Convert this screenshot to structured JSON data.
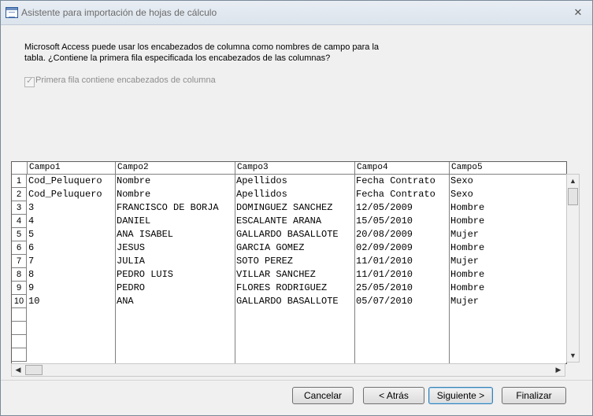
{
  "window": {
    "title": "Asistente para importación de hojas de cálculo",
    "close_icon": "close-icon"
  },
  "intro": {
    "line1": "Microsoft Access puede usar los encabezados de columna como nombres de campo para la",
    "line2": "tabla. ¿Contiene la primera fila especificada los encabezados de las columnas?"
  },
  "first_row_checkbox": {
    "label": "Primera fila contiene encabezados de columna",
    "checked": true,
    "enabled": false
  },
  "grid": {
    "columns": [
      "Campo1",
      "Campo2",
      "Campo3",
      "Campo4",
      "Campo5"
    ],
    "row_numbers": [
      "1",
      "2",
      "3",
      "4",
      "5",
      "6",
      "7",
      "8",
      "9",
      "10"
    ],
    "rows": [
      [
        "Cod_Peluquero",
        "Nombre",
        "Apellidos",
        "Fecha Contrato",
        "Sexo"
      ],
      [
        "Cod_Peluquero",
        "Nombre",
        "Apellidos",
        "Fecha Contrato",
        "Sexo"
      ],
      [
        "3",
        "FRANCISCO DE BORJA",
        "DOMINGUEZ SANCHEZ",
        "12/05/2009",
        "Hombre"
      ],
      [
        "4",
        "DANIEL",
        "ESCALANTE ARANA",
        "15/05/2010",
        "Hombre"
      ],
      [
        "5",
        "ANA ISABEL",
        "GALLARDO BASALLOTE",
        "20/08/2009",
        "Mujer"
      ],
      [
        "6",
        "JESUS",
        "GARCIA GOMEZ",
        "02/09/2009",
        "Hombre"
      ],
      [
        "7",
        "JULIA",
        "SOTO PEREZ",
        "11/01/2010",
        "Mujer"
      ],
      [
        "8",
        "PEDRO LUIS",
        "VILLAR SANCHEZ",
        "11/01/2010",
        "Hombre"
      ],
      [
        "9",
        "PEDRO",
        "FLORES RODRIGUEZ",
        "25/05/2010",
        "Hombre"
      ],
      [
        "10",
        "ANA",
        "GALLARDO BASALLOTE",
        "05/07/2010",
        "Mujer"
      ]
    ]
  },
  "buttons": {
    "cancel": "Cancelar",
    "back": "< Atrás",
    "next": "Siguiente >",
    "finish": "Finalizar"
  },
  "colors": {
    "default_button_border": "#3c7fb1",
    "disabled_text": "#8d8d8d"
  }
}
